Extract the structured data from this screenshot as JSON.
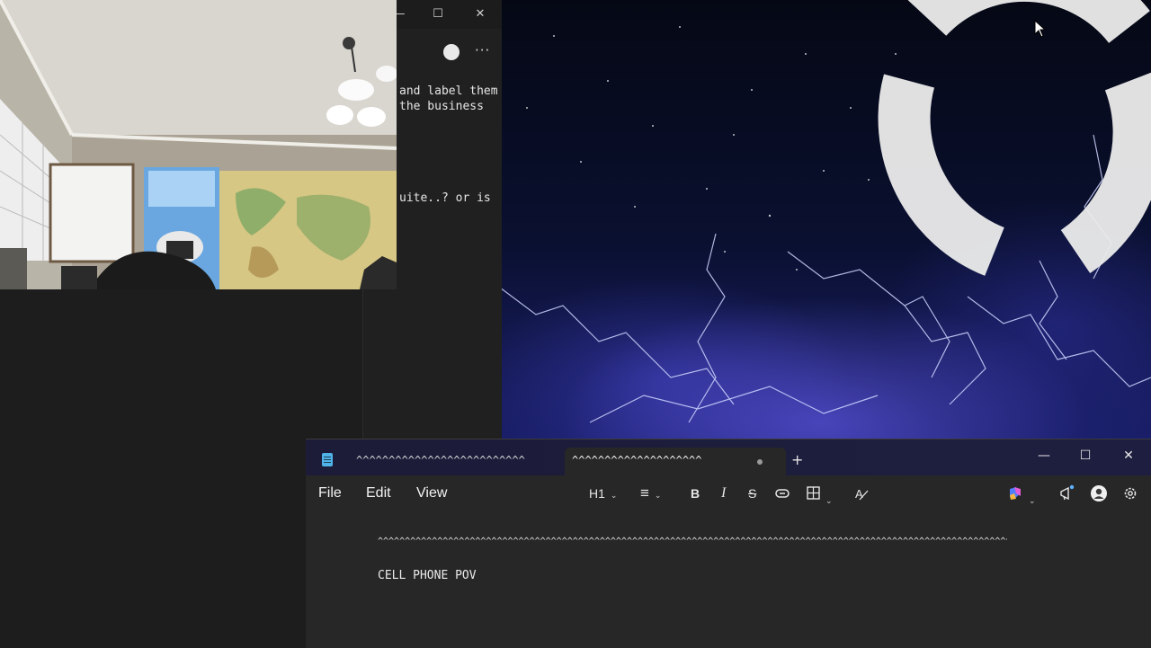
{
  "background_window": {
    "text_lines": [
      "and label them",
      "the business",
      "uite..? or is"
    ]
  },
  "notepad": {
    "tabs": [
      {
        "title": "^^^^^^^^^^^^^^^^^^^^^^^^^^",
        "unsaved": true
      },
      {
        "title": "^^^^^^^^^^^^^^^^^^^^",
        "unsaved": true,
        "active": true
      }
    ],
    "new_tab_label": "+",
    "window_controls": {
      "minimize": "—",
      "maximize": "☐",
      "close": "✕"
    },
    "menu": {
      "file": "File",
      "edit": "Edit",
      "view": "View"
    },
    "toolbar": {
      "heading": "H1",
      "list_icon": "≡",
      "bold": "B",
      "italic": "I",
      "strikethrough": "S",
      "link_icon": "link-icon",
      "table_icon": "table-icon",
      "clear_format_icon": "clear-format-icon",
      "copilot_icon": "copilot-icon",
      "feedback_icon": "megaphone-icon",
      "settings_icon": "gear-icon"
    },
    "editor": {
      "lines": [
        "^^^^^^^^^^^^^^^^^^^^^^^^^^^^^^^^^^^^^^^^^^^^^^^^^^^^^^^^^^^^^^^^^^^^^^^^^^^^^^^^^^^^^^^^^^^^^^^^^^^^^^^^^^^^^^^^^^^^^^^^^^^^^^^^^^^^^^^^^^^^^^^^^^^^^^^^^^^^^^^^^^^^^^^^^^^^^^^^^^^^^^^^^^^^^^^^",
        "CELL PHONE POV"
      ]
    }
  },
  "colors": {
    "notepad_titlebar": "#1e1e40",
    "notepad_body": "#272727",
    "wallpaper_glow": "#6e64ff"
  }
}
